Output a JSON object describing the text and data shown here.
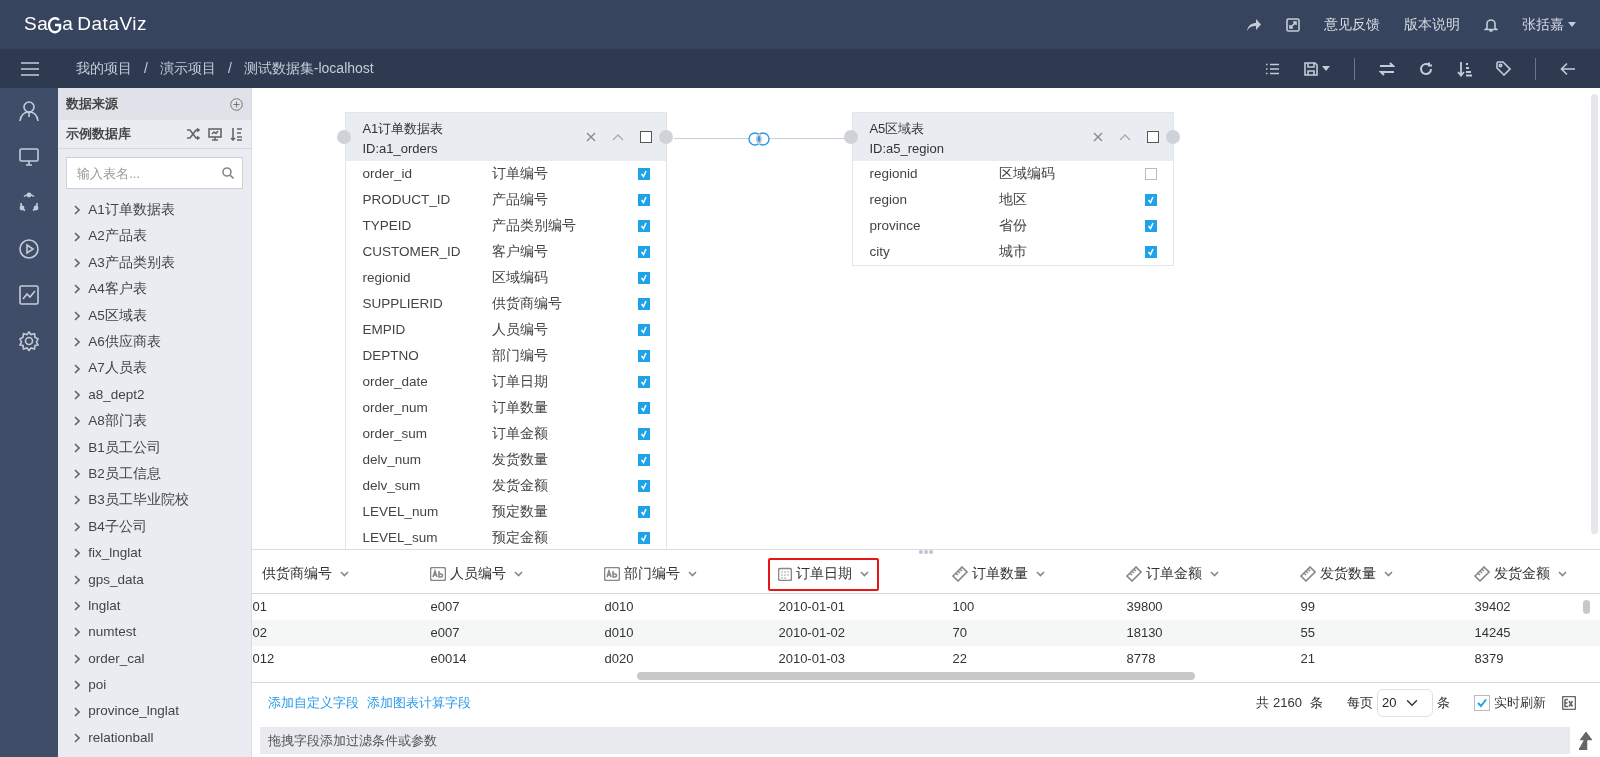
{
  "app": {
    "logo_left": "Sa",
    "logo_right": "a",
    "product": "DataViz"
  },
  "header_links": [
    "意见反馈",
    "版本说明"
  ],
  "user": "张括嘉",
  "breadcrumb": [
    {
      "label": "我的项目",
      "separator": "/"
    },
    {
      "label": "演示项目",
      "separator": "/"
    },
    {
      "label": "测试数据集-localhost"
    }
  ],
  "sidebar": {
    "title": "数据来源",
    "database": "示例数据库",
    "search": {
      "placeholder": "输入表名..."
    },
    "tables": [
      {
        "label": "A1订单数据表",
        "expanded": false
      },
      {
        "label": "A2产品表",
        "expanded": false
      },
      {
        "label": "A3产品类别表",
        "expanded": false
      },
      {
        "label": "A4客户表",
        "expanded": false
      },
      {
        "label": "A5区域表",
        "expanded": false
      },
      {
        "label": "A6供应商表",
        "expanded": false
      },
      {
        "label": "A7人员表",
        "expanded": false
      },
      {
        "label": "a8_dept2",
        "expanded": false
      },
      {
        "label": "A8部门表",
        "expanded": false
      },
      {
        "label": "B1员工公司",
        "expanded": false
      },
      {
        "label": "B2员工信息",
        "expanded": false
      },
      {
        "label": "B3员工毕业院校",
        "expanded": false
      },
      {
        "label": "B4子公司",
        "expanded": false
      },
      {
        "label": "fix_lnglat",
        "expanded": false
      },
      {
        "label": "gps_data",
        "expanded": false
      },
      {
        "label": "lnglat",
        "expanded": false
      },
      {
        "label": "numtest",
        "expanded": false
      },
      {
        "label": "order_cal",
        "expanded": false
      },
      {
        "label": "poi",
        "expanded": false
      },
      {
        "label": "province_lnglat",
        "expanded": false
      },
      {
        "label": "relationball",
        "expanded": false
      }
    ]
  },
  "canvas": {
    "tables": [
      {
        "title": "A1订单数据表",
        "id": "ID:a1_orders",
        "checked": false,
        "fields": [
          {
            "name": "order_id",
            "label": "订单编号",
            "checked": true
          },
          {
            "name": "PRODUCT_ID",
            "label": "产品编号",
            "checked": true
          },
          {
            "name": "TYPEID",
            "label": "产品类别编号",
            "checked": true
          },
          {
            "name": "CUSTOMER_ID",
            "label": "客户编号",
            "checked": true
          },
          {
            "name": "regionid",
            "label": "区域编码",
            "checked": true
          },
          {
            "name": "SUPPLIERID",
            "label": "供货商编号",
            "checked": true
          },
          {
            "name": "EMPID",
            "label": "人员编号",
            "checked": true
          },
          {
            "name": "DEPTNO",
            "label": "部门编号",
            "checked": true
          },
          {
            "name": "order_date",
            "label": "订单日期",
            "checked": true
          },
          {
            "name": "order_num",
            "label": "订单数量",
            "checked": true
          },
          {
            "name": "order_sum",
            "label": "订单金额",
            "checked": true
          },
          {
            "name": "delv_num",
            "label": "发货数量",
            "checked": true
          },
          {
            "name": "delv_sum",
            "label": "发货金额",
            "checked": true
          },
          {
            "name": "LEVEL_num",
            "label": "预定数量",
            "checked": true
          },
          {
            "name": "LEVEL_sum",
            "label": "预定金额",
            "checked": true
          }
        ]
      },
      {
        "title": "A5区域表",
        "id": "ID:a5_region",
        "checked": false,
        "fields": [
          {
            "name": "regionid",
            "label": "区域编码",
            "checked": false
          },
          {
            "name": "region",
            "label": "地区",
            "checked": true
          },
          {
            "name": "province",
            "label": "省份",
            "checked": true
          },
          {
            "name": "city",
            "label": "城市",
            "checked": true
          }
        ]
      }
    ]
  },
  "grid": {
    "columns": [
      {
        "label": "供货商编号",
        "highlighted": false
      },
      {
        "label": "人员编号",
        "kind": "text",
        "highlighted": false
      },
      {
        "label": "部门编号",
        "kind": "text",
        "highlighted": false
      },
      {
        "label": "订单日期",
        "kind": "date",
        "highlighted": true
      },
      {
        "label": "订单数量",
        "kind": "number",
        "highlighted": false
      },
      {
        "label": "订单金额",
        "kind": "number",
        "highlighted": false
      },
      {
        "label": "发货数量",
        "kind": "number",
        "highlighted": false
      },
      {
        "label": "发货金额",
        "kind": "number",
        "highlighted": false
      }
    ],
    "rows": [
      [
        "01",
        "e007",
        "d010",
        "2010-01-01",
        "100",
        "39800",
        "99",
        "39402"
      ],
      [
        "02",
        "e007",
        "d010",
        "2010-01-02",
        "70",
        "18130",
        "55",
        "14245"
      ],
      [
        "012",
        "e0014",
        "d020",
        "2010-01-03",
        "22",
        "8778",
        "21",
        "8379"
      ]
    ]
  },
  "footer": {
    "links": [
      "添加自定义字段",
      "添加图表计算字段"
    ],
    "total": "共 2160",
    "total_unit": "条",
    "page_size_label": "每页",
    "page_size": "20",
    "page_size_unit": "条",
    "realtime": {
      "label": "实时刷新",
      "checked": true
    },
    "filter_hint": "拖拽字段添加过滤条件或参数"
  }
}
